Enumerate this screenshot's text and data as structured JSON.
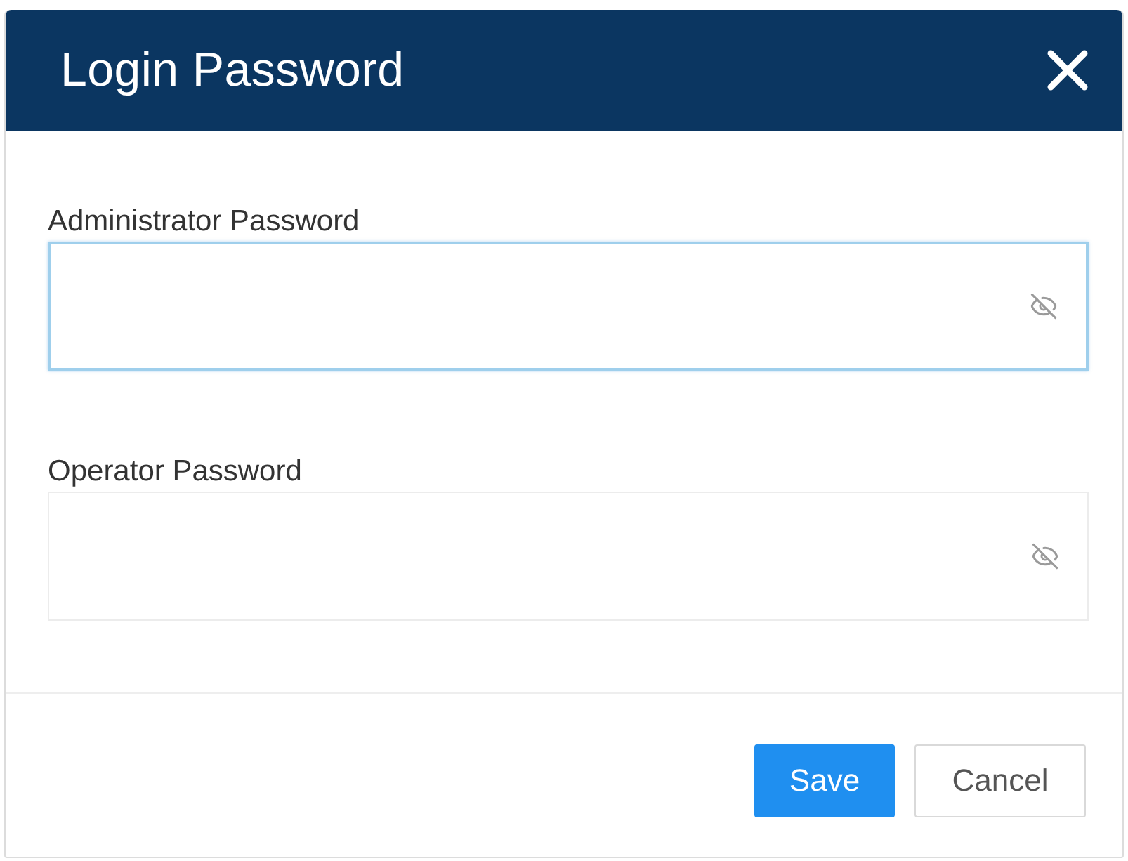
{
  "dialog": {
    "title": "Login Password"
  },
  "fields": [
    {
      "label": "Administrator Password",
      "focused": true
    },
    {
      "label": "Operator Password",
      "focused": false
    }
  ],
  "buttons": [
    {
      "label": "Save",
      "kind": "primary"
    },
    {
      "label": "Cancel",
      "kind": "secondary"
    }
  ]
}
